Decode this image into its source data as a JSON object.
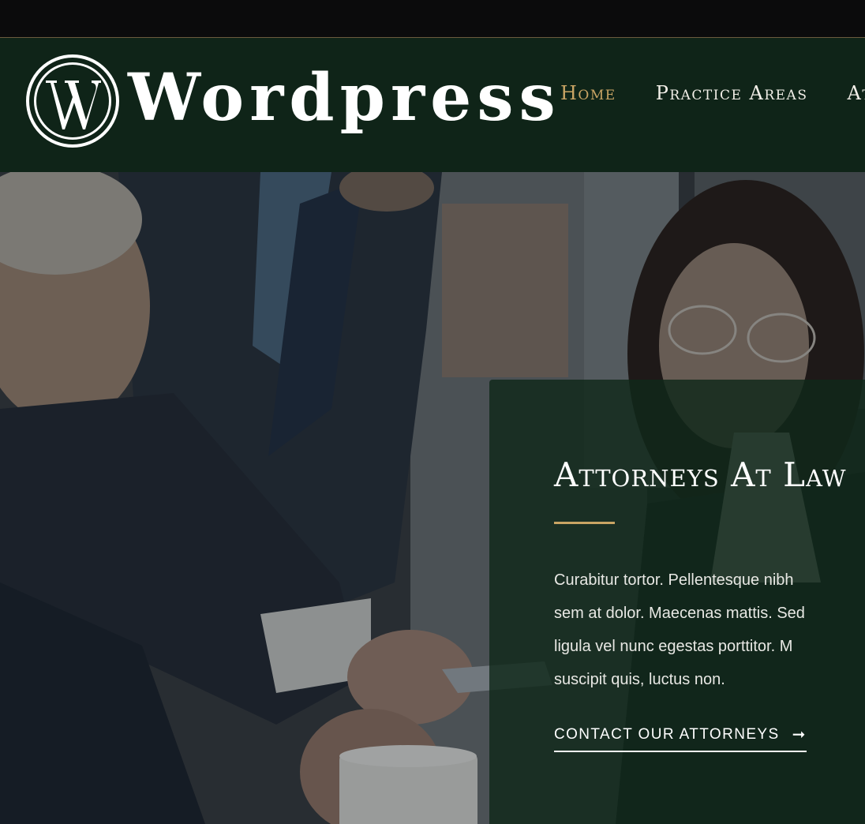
{
  "header": {
    "logo_text": "Wordpress",
    "nav": [
      {
        "label": "Home",
        "active": true
      },
      {
        "label": "Practice Areas",
        "active": false
      },
      {
        "label": "At",
        "active": false
      }
    ]
  },
  "hero": {
    "title": "Attorneys At Law",
    "description_lines": [
      "Curabitur tortor. Pellentesque nibh",
      "sem at dolor. Maecenas mattis. Sed",
      "ligula vel nunc egestas porttitor. M",
      "suscipit quis, luctus non."
    ],
    "cta_label": "CONTACT OUR ATTORNEYS",
    "cta_icon": "arrow-right-icon"
  },
  "colors": {
    "header_bg": "#0f2418",
    "accent_gold": "#c9a464",
    "overlay_green": "#10281a",
    "text_white": "#ffffff"
  }
}
